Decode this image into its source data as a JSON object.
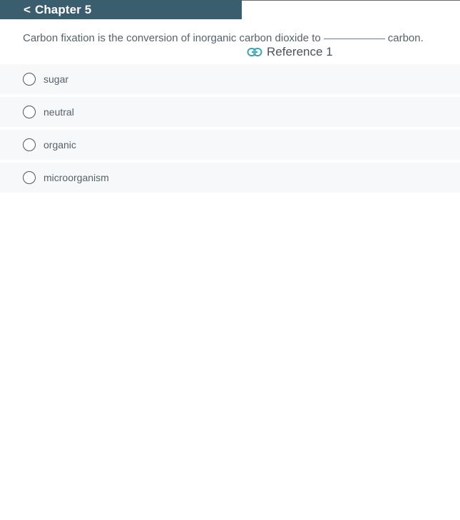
{
  "header": {
    "back_chevron": "<",
    "chapter_title": "Chapter 5",
    "bar_color": "#3a5e6e"
  },
  "question": {
    "text_before": "Carbon fixation is the conversion of inorganic carbon dioxide to",
    "text_after": "carbon."
  },
  "reference": {
    "icon": "link-icon",
    "label": "Reference 1",
    "icon_color": "#3ba7ad"
  },
  "options": [
    {
      "label": "sugar"
    },
    {
      "label": "neutral"
    },
    {
      "label": "organic"
    },
    {
      "label": "microorganism"
    }
  ]
}
